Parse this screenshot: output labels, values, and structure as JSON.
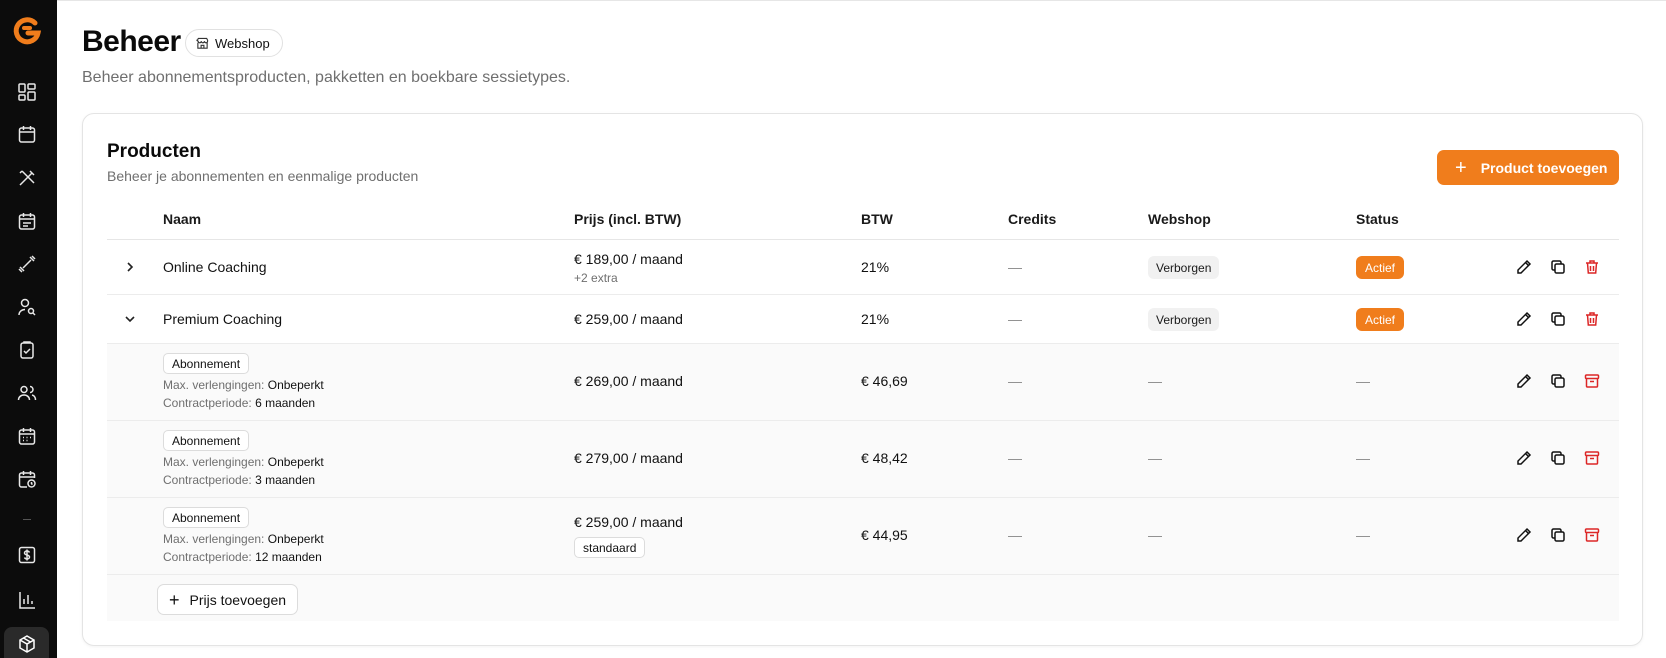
{
  "sidebar": {
    "brand_color": "#f07d1c",
    "icons": [
      "dashboard-icon",
      "calendar-icon",
      "tools-icon",
      "calendar-check-icon",
      "dumbbell-icon",
      "user-search-icon",
      "clipboard-check-icon",
      "users-icon",
      "calendar-grid-icon",
      "calendar-clock-icon",
      "dollar-icon",
      "bar-chart-icon",
      "package-icon"
    ]
  },
  "header": {
    "title": "Beheer",
    "chip_label": "Webshop",
    "subtitle": "Beheer abonnementsproducten, pakketten en boekbare sessietypes."
  },
  "card": {
    "title": "Producten",
    "subtitle": "Beheer je abonnementen en eenmalige producten",
    "add_button": "Product toevoegen"
  },
  "table": {
    "columns": [
      "Naam",
      "Prijs (incl. BTW)",
      "BTW",
      "Credits",
      "Webshop",
      "Status"
    ],
    "products": [
      {
        "name": "Online Coaching",
        "price": "€ 189,00 / maand",
        "price_extra": "+2 extra",
        "vat": "21%",
        "credits": "—",
        "webshop": "Verborgen",
        "status": "Actief"
      },
      {
        "name": "Premium Coaching",
        "price": "€ 259,00 / maand",
        "vat": "21%",
        "credits": "—",
        "webshop": "Verborgen",
        "status": "Actief"
      }
    ],
    "prices": [
      {
        "type": "Abonnement",
        "renewals_label": "Max. verlengingen:",
        "renewals_value": "Onbeperkt",
        "period_label": "Contractperiode:",
        "period_value": "6 maanden",
        "price": "€ 269,00 / maand",
        "vat": "€ 46,69",
        "credits": "—",
        "webshop": "—",
        "status": "—"
      },
      {
        "type": "Abonnement",
        "renewals_label": "Max. verlengingen:",
        "renewals_value": "Onbeperkt",
        "period_label": "Contractperiode:",
        "period_value": "3 maanden",
        "price": "€ 279,00 / maand",
        "vat": "€ 48,42",
        "credits": "—",
        "webshop": "—",
        "status": "—"
      },
      {
        "type": "Abonnement",
        "renewals_label": "Max. verlengingen:",
        "renewals_value": "Onbeperkt",
        "period_label": "Contractperiode:",
        "period_value": "12 maanden",
        "price": "€ 259,00 / maand",
        "price_tag": "standaard",
        "vat": "€ 44,95",
        "credits": "—",
        "webshop": "—",
        "status": "—"
      }
    ],
    "add_price_button": "Prijs toevoegen"
  },
  "colors": {
    "accent": "#f07d1c",
    "danger": "#dc2626"
  }
}
